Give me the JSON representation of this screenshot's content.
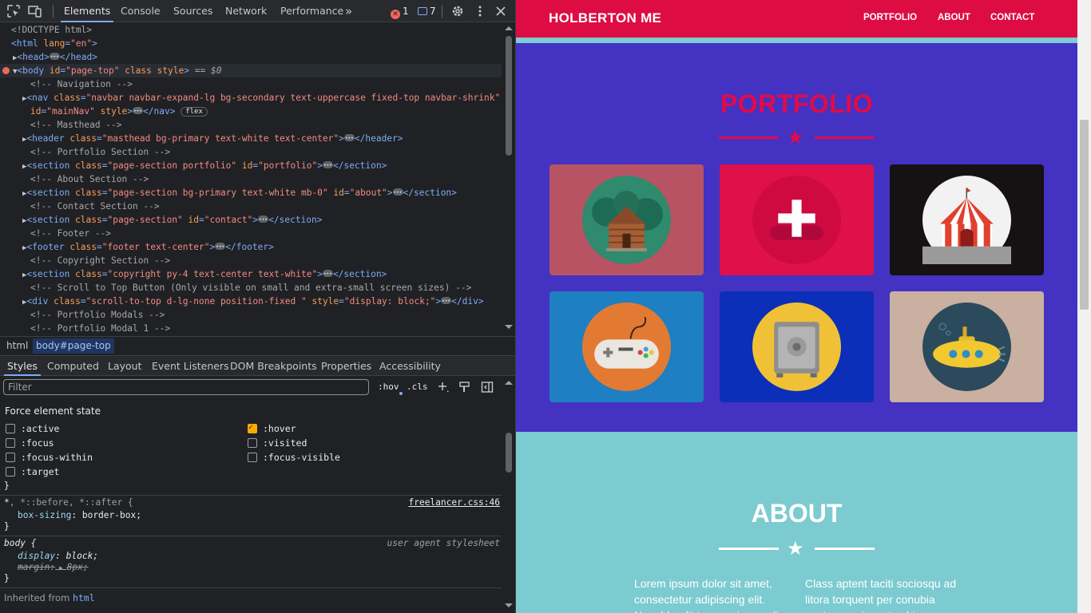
{
  "devtools": {
    "tabs": [
      "Elements",
      "Console",
      "Sources",
      "Network",
      "Performance"
    ],
    "more_tabs": "»",
    "error_count": "1",
    "message_count": "7",
    "dom_lines": {
      "l1": "<!DOCTYPE html>",
      "l2_tag": "<html",
      "l2_attr": "lang",
      "l2_val": "\"en\"",
      "l3": "<head>",
      "l3_end": "</head>",
      "l4_tag": "<body",
      "l4_id_attr": "id",
      "l4_id_val": "\"page-top\"",
      "l4_class": "class",
      "l4_style": "style",
      "l4_end": ">",
      "l4_eq": "== $0",
      "c_nav": "<!-- Navigation -->",
      "nav_open": "<nav",
      "nav_class_attr": "class",
      "nav_class_val": "\"navbar navbar-expand-lg bg-secondary text-uppercase fixed-top navbar-shrink\"",
      "nav_id_attr": "id",
      "nav_id_val": "\"mainNav\"",
      "nav_style": "style",
      "nav_close": "</nav>",
      "nav_pill": "flex",
      "c_masthead": "<!-- Masthead -->",
      "header_open": "<header",
      "header_class_attr": "class",
      "header_class_val": "\"masthead bg-primary text-white text-center\"",
      "header_close": "</header>",
      "c_portfolio": "<!-- Portfolio Section -->",
      "sec1_open": "<section",
      "sec1_class_attr": "class",
      "sec1_class_val": "\"page-section portfolio\"",
      "sec1_id_attr": "id",
      "sec1_id_val": "\"portfolio\"",
      "sec_close": "</section>",
      "c_about": "<!-- About Section -->",
      "sec2_class_val": "\"page-section bg-primary text-white mb-0\"",
      "sec2_id_val": "\"about\"",
      "c_contact": "<!-- Contact Section -->",
      "sec3_class_val": "\"page-section\"",
      "sec3_id_val": "\"contact\"",
      "c_footer": "<!-- Footer -->",
      "footer_open": "<footer",
      "footer_class_val": "\"footer text-center\"",
      "footer_close": "</footer>",
      "c_copyright": "<!-- Copyright Section -->",
      "sec4_class_val": "\"copyright py-4 text-center text-white\"",
      "c_scroll": "<!-- Scroll to Top Button (Only visible on small and extra-small screen sizes) -->",
      "div_open": "<div",
      "div_class_val": "\"scroll-to-top d-lg-none position-fixed \"",
      "div_style_attr": "style",
      "div_style_val": "\"display: block;\"",
      "div_close": "</div>",
      "c_modals": "<!-- Portfolio Modals -->",
      "c_modal1": "<!-- Portfolio Modal 1 -->"
    },
    "breadcrumbs": [
      "html",
      "body#page-top"
    ],
    "style_tabs": [
      "Styles",
      "Computed",
      "Layout",
      "Event Listeners",
      "DOM Breakpoints",
      "Properties",
      "Accessibility"
    ],
    "filter_placeholder": "Filter",
    "hov_label": ":hov",
    "cls_label": ".cls",
    "force_state_title": "Force element state",
    "states_left": [
      ":active",
      ":focus",
      ":focus-within",
      ":target"
    ],
    "states_right": [
      ":hover",
      ":visited",
      ":focus-visible"
    ],
    "checked_state": ":hover",
    "rules": {
      "close_brace": "}",
      "r1_selector": "*",
      "r1_selector_rest": ", *::before, *::after {",
      "r1_source": "freelancer.css:46",
      "r1_prop": "box-sizing",
      "r1_val": "border-box;",
      "r2_selector": "body {",
      "r2_source": "user agent stylesheet",
      "r2_prop1": "display",
      "r2_val1": "block;",
      "r2_prop2": "margin",
      "r2_val2": "8px;",
      "inherited_label": "Inherited from",
      "inherited_tag": "html"
    }
  },
  "page": {
    "brand": "HOLBERTON ME",
    "nav_links": [
      "PORTFOLIO",
      "ABOUT",
      "CONTACT"
    ],
    "portfolio_title": "PORTFOLIO",
    "about_title": "ABOUT",
    "about_col1": "Lorem ipsum dolor sit amet, consectetur adipiscing elit. Nam blandit tempus ipsum dig",
    "about_col2": "Class aptent taciti sociosqu ad litora torquent per conubia nostra, per inceptos hi",
    "colors": {
      "nav_bg": "#dd0d44",
      "portfolio_bg": "#4432c2",
      "accent": "#e40a46",
      "about_bg": "#7ccbd0"
    },
    "portfolio_items": [
      {
        "name": "cabin",
        "bg": "#b85364"
      },
      {
        "name": "cake",
        "bg": "#e0104a"
      },
      {
        "name": "circus",
        "bg": "#161112"
      },
      {
        "name": "game",
        "bg": "#1e7fc2"
      },
      {
        "name": "safe",
        "bg": "#0b2fb8"
      },
      {
        "name": "submarine",
        "bg": "#c9b0a0"
      }
    ]
  }
}
